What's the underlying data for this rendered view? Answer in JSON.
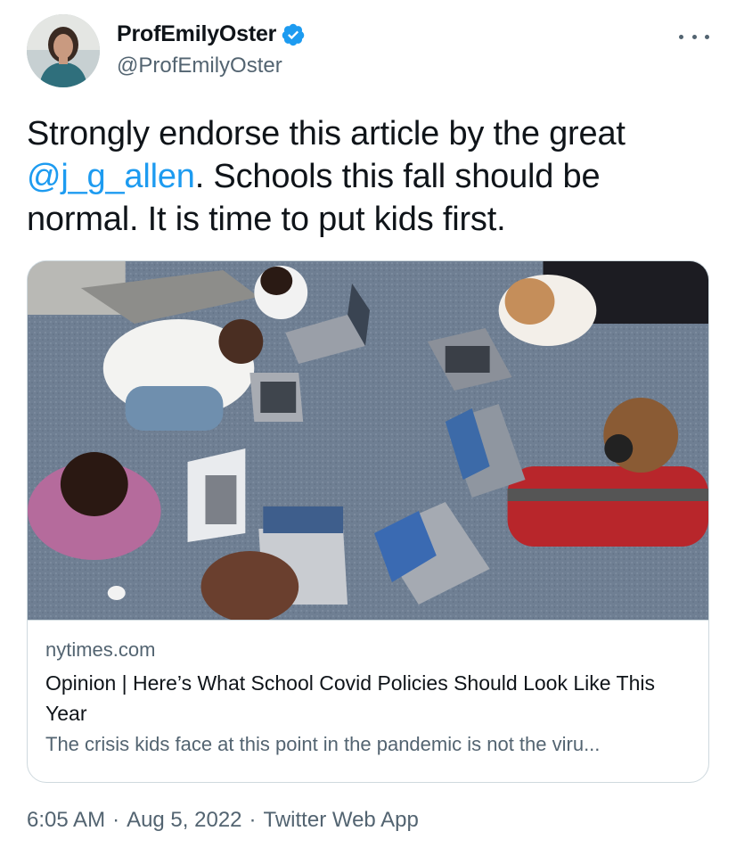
{
  "author": {
    "display_name": "ProfEmilyOster",
    "handle": "@ProfEmilyOster",
    "verified": true
  },
  "icons": {
    "verified": "verified-badge-icon",
    "more": "more-options-icon"
  },
  "tweet": {
    "text_part1": "Strongly endorse this article by the great ",
    "mention": "@j_g_allen",
    "text_part2": ".  Schools this fall should be normal. It is time to put kids first."
  },
  "card": {
    "domain": "nytimes.com",
    "title": "Opinion | Here’s What School Covid Policies Should Look Like This Year",
    "description": "The crisis kids face at this point in the pandemic is not the viru..."
  },
  "meta": {
    "time": "6:05 AM",
    "separator": "·",
    "date": "Aug 5, 2022",
    "source": "Twitter Web App"
  },
  "colors": {
    "link": "#1d9bf0",
    "text": "#0f1419",
    "secondary": "#536471",
    "border": "#cfd9de",
    "verified": "#1d9bf0"
  }
}
